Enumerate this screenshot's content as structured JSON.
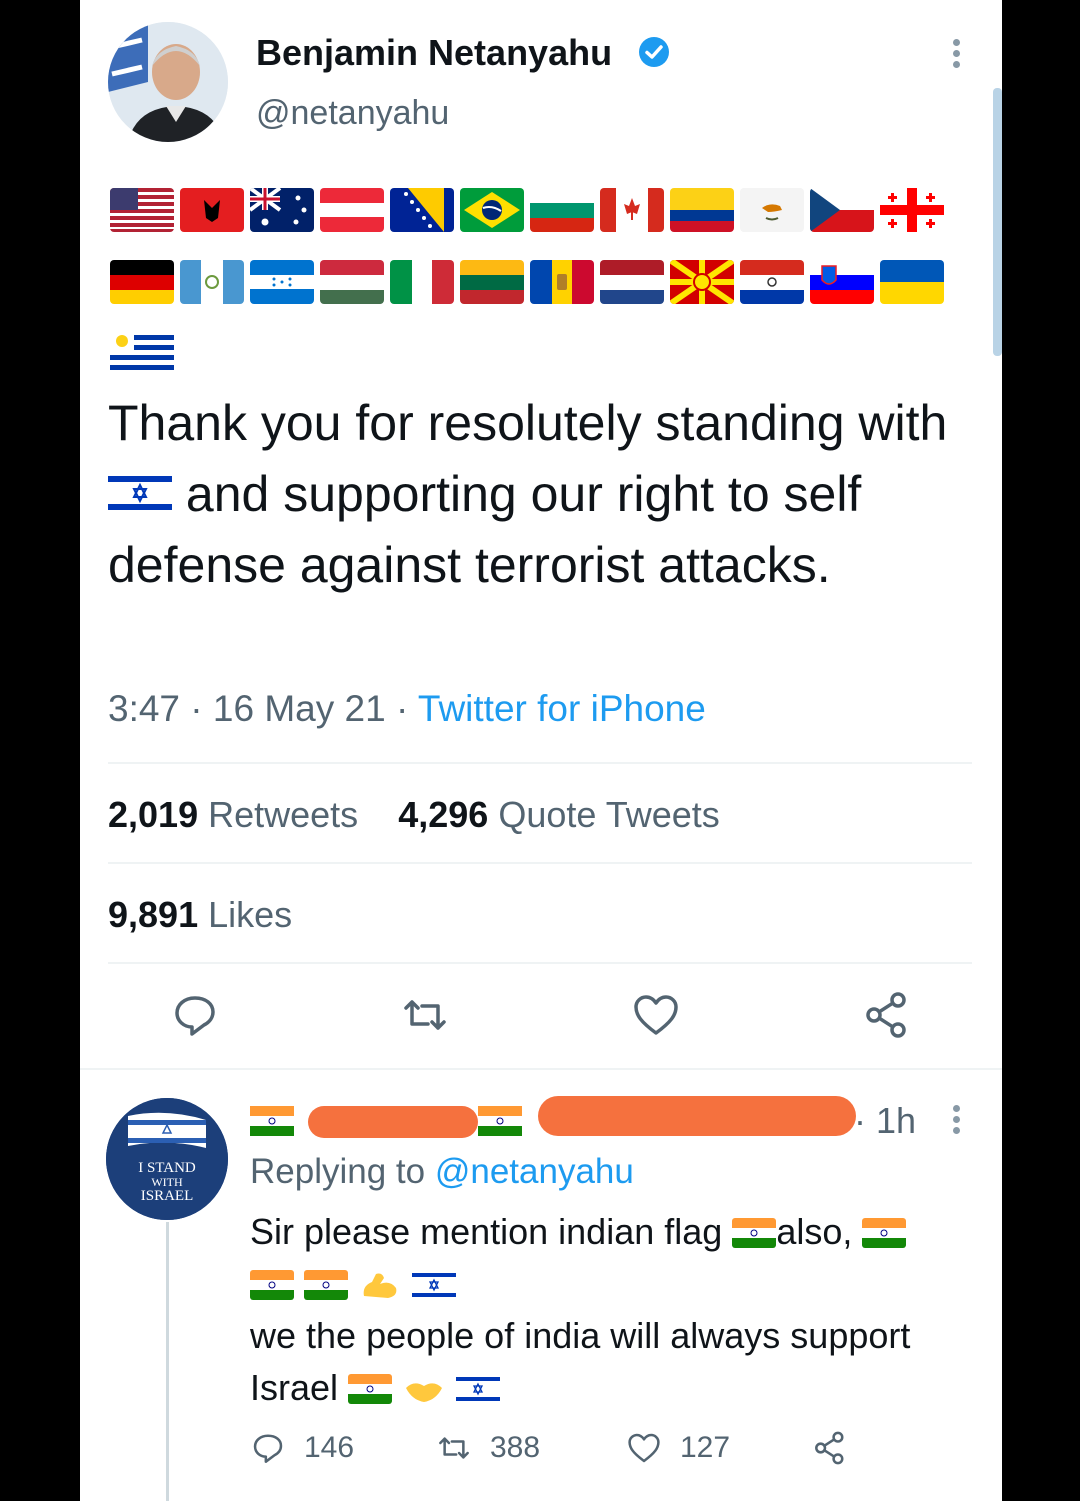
{
  "tweet": {
    "author_name": "Benjamin Netanyahu",
    "handle": "@netanyahu",
    "text_part1": "Thank you for resolutely standing with",
    "text_part2": "and supporting our right to self defense against terrorist attacks.",
    "time": "3:47",
    "date": "16 May 21",
    "source": "Twitter for iPhone",
    "retweets_count": "2,019",
    "retweets_label": "Retweets",
    "quotes_count": "4,296",
    "quotes_label": "Quote Tweets",
    "likes_count": "9,891",
    "likes_label": "Likes"
  },
  "flags_row1": [
    "us-flag",
    "albania-flag",
    "australia-flag",
    "austria-flag",
    "bosnia-flag",
    "brazil-flag",
    "bulgaria-flag",
    "canada-flag",
    "colombia-flag",
    "cyprus-flag",
    "czech-flag",
    "georgia-flag"
  ],
  "flags_row2": [
    "germany-flag",
    "guatemala-flag",
    "honduras-flag",
    "hungary-flag",
    "italy-flag",
    "lithuania-flag",
    "moldova-flag",
    "netherlands-flag",
    "north-macedonia-flag",
    "paraguay-flag",
    "slovenia-flag",
    "ukraine-flag"
  ],
  "flags_row3": [
    "uruguay-flag"
  ],
  "reply": {
    "time": "1h",
    "replying_prefix": "Replying to",
    "replying_handle": "@netanyahu",
    "line1": "Sir please mention indian flag",
    "line1b": "also,",
    "line2": "we the people of india will always support",
    "line3": "Israel",
    "reply_count": "146",
    "retweet_count": "388",
    "like_count": "127",
    "avatar_text": "I STAND WITH ISRAEL"
  },
  "colors": {
    "link": "#1d9bf0",
    "secondary_text": "#536471",
    "redaction": "#f5713e"
  }
}
